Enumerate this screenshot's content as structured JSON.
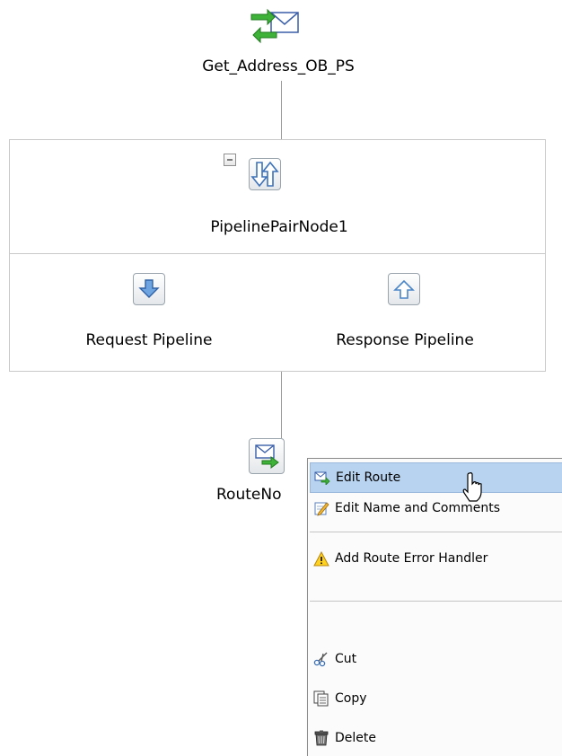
{
  "nodes": {
    "proxy_label": "Get_Address_OB_PS",
    "pipeline_pair_label": "PipelinePairNode1",
    "request_pipeline_label": "Request Pipeline",
    "response_pipeline_label": "Response Pipeline",
    "route_node_label": "RouteNo"
  },
  "context_menu": {
    "items": [
      {
        "label": "Edit Route",
        "icon": "route-edit-icon"
      },
      {
        "label": "Edit Name and Comments",
        "icon": "pencil-notepad-icon"
      },
      {
        "label": "Add Route Error Handler",
        "icon": "warning-icon"
      },
      {
        "label": "Cut",
        "icon": "scissors-icon"
      },
      {
        "label": "Copy",
        "icon": "copy-icon"
      },
      {
        "label": "Delete",
        "icon": "trash-icon"
      }
    ]
  },
  "colors": {
    "menu_highlight": "#b7d3f0",
    "connector": "#9a9a9a",
    "arrow_blue": "#4b86c8"
  }
}
